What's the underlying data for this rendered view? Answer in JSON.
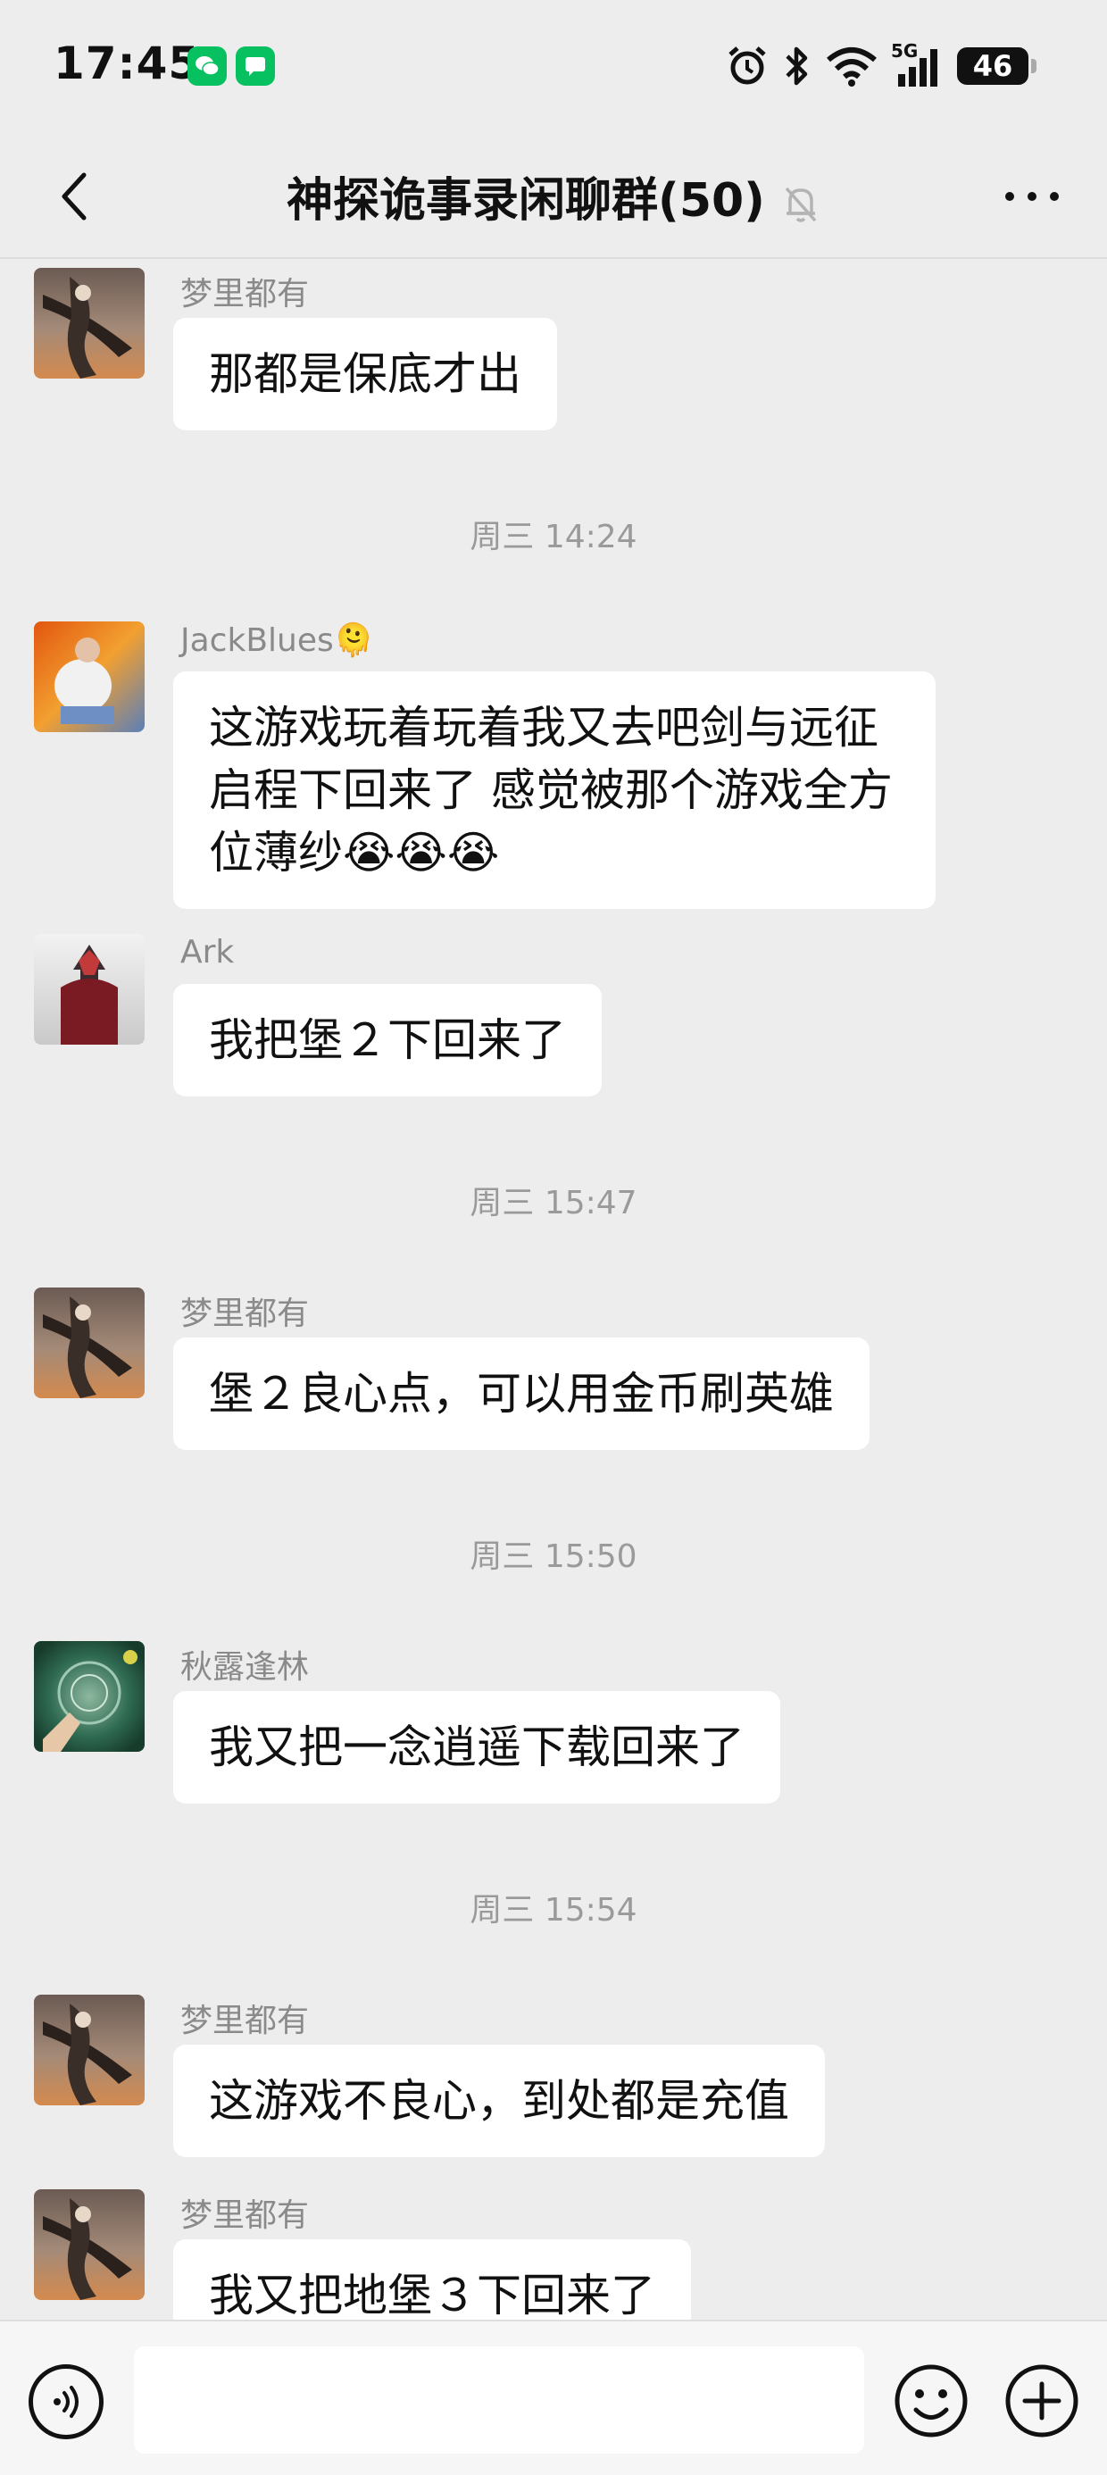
{
  "status_bar": {
    "time": "17:45",
    "battery": "46",
    "network": "5G",
    "icons": [
      "wechat-icon",
      "messages-icon",
      "alarm-icon",
      "bluetooth-icon",
      "wifi-icon",
      "signal-icon",
      "battery-icon"
    ]
  },
  "header": {
    "title": "神探诡事录闲聊群(50)",
    "icons": [
      "back-icon",
      "mute-bell-icon",
      "more-icon"
    ]
  },
  "messages": [
    {
      "type": "message",
      "sender": "梦里都有",
      "text": "那都是保底才出",
      "avatar": "dream-avatar"
    },
    {
      "type": "time",
      "text": "周三 14:24"
    },
    {
      "type": "message",
      "sender": "JackBlues🫠",
      "text": "这游戏玩着玩着我又去吧剑与远征启程下回来了 感觉被那个游戏全方位薄纱😭😭😭",
      "avatar": "jack-avatar"
    },
    {
      "type": "message",
      "sender": "Ark",
      "text": "我把堡２下回来了",
      "avatar": "ark-avatar"
    },
    {
      "type": "time",
      "text": "周三 15:47"
    },
    {
      "type": "message",
      "sender": "梦里都有",
      "text": "堡２良心点，可以用金币刷英雄",
      "avatar": "dream-avatar"
    },
    {
      "type": "time",
      "text": "周三 15:50"
    },
    {
      "type": "message",
      "sender": "秋露逢林",
      "text": "我又把一念逍遥下载回来了",
      "avatar": "qiulu-avatar"
    },
    {
      "type": "time",
      "text": "周三 15:54"
    },
    {
      "type": "message",
      "sender": "梦里都有",
      "text": "这游戏不良心，到处都是充值",
      "avatar": "dream-avatar"
    },
    {
      "type": "message",
      "sender": "梦里都有",
      "text": "我又把地堡３下回来了",
      "avatar": "dream-avatar"
    }
  ],
  "input_bar": {
    "input_value": "",
    "icons": [
      "voice-icon",
      "emoji-icon",
      "plus-icon"
    ]
  }
}
